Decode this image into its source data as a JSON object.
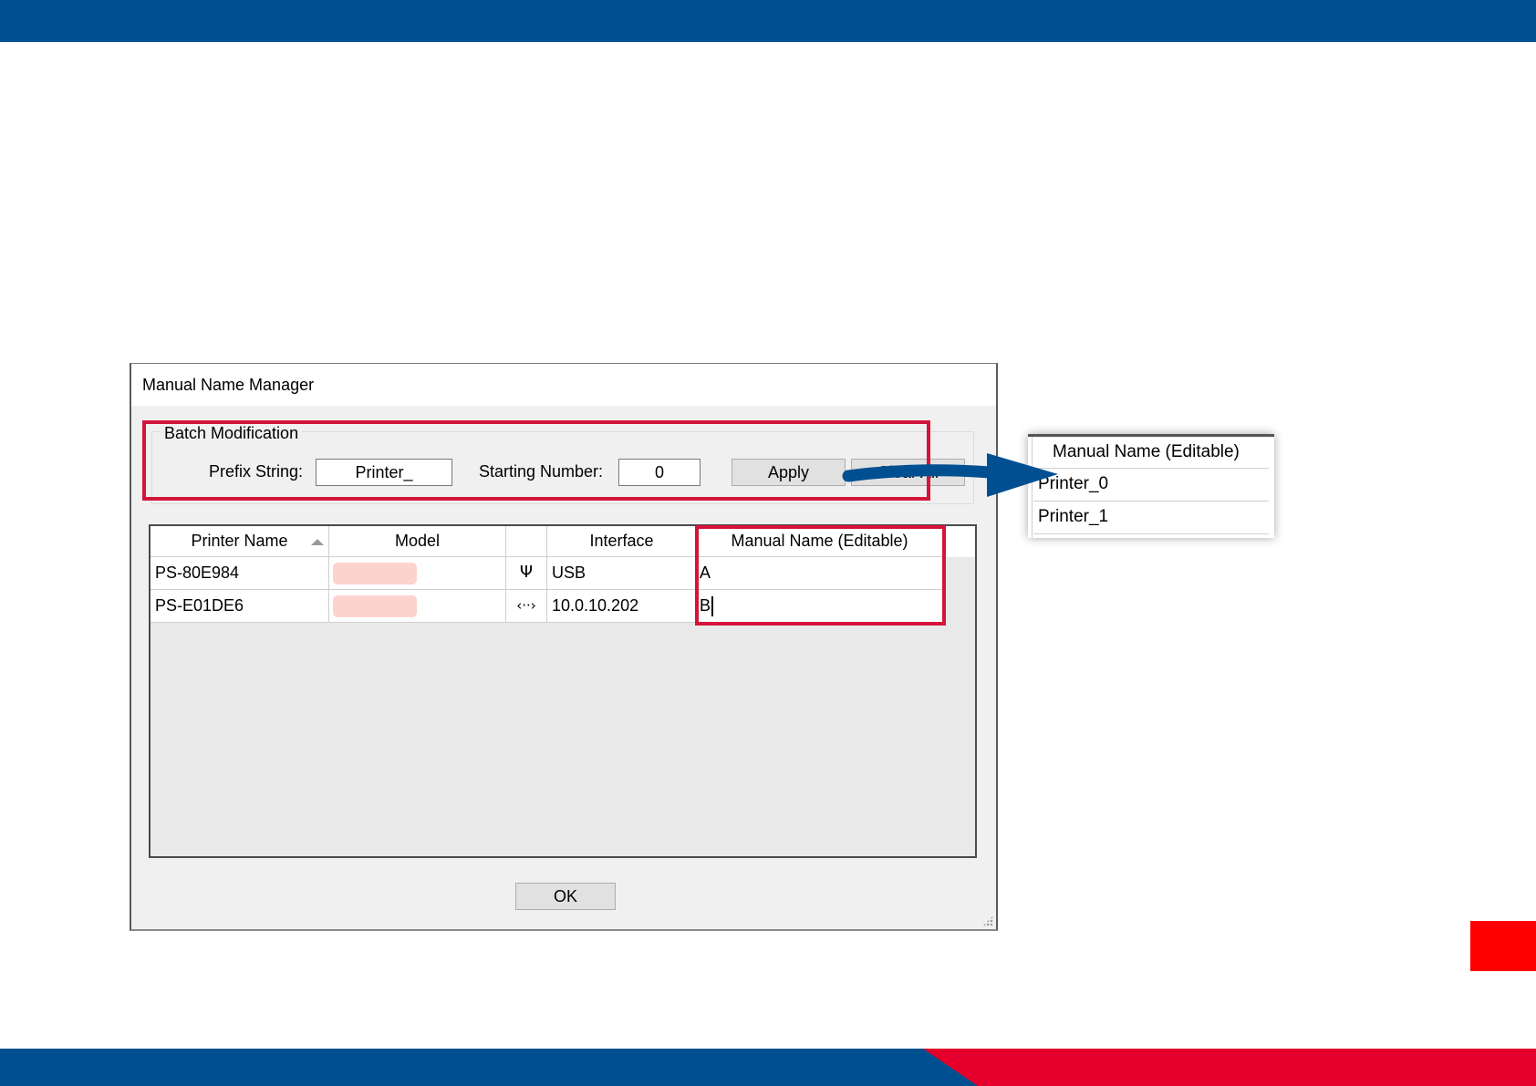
{
  "dialog": {
    "title": "Manual Name Manager",
    "batch_group": {
      "label": "Batch Modification",
      "prefix_label": "Prefix String:",
      "prefix_value": "Printer_",
      "starting_label": "Starting Number:",
      "starting_value": "0",
      "apply_label": "Apply",
      "clear_label": "Clear All"
    },
    "table": {
      "columns": [
        "Printer Name",
        "Model",
        "",
        "Interface",
        "Manual Name (Editable)"
      ],
      "rows": [
        {
          "printer_name": "PS-80E984",
          "interface_icon": "usb-icon",
          "interface_glyph": "Ψ",
          "interface": "USB",
          "manual_name": "A"
        },
        {
          "printer_name": "PS-E01DE6",
          "interface_icon": "network-icon",
          "interface_glyph": "‹··›",
          "interface": "10.0.10.202",
          "manual_name": "B"
        }
      ]
    },
    "ok_label": "OK"
  },
  "callout": {
    "header": "Manual Name (Editable)",
    "rows": [
      "Printer_0",
      "Printer_1"
    ]
  },
  "colors": {
    "brand_blue": "#005091",
    "brand_red": "#e4002b",
    "highlight": "#d4143a"
  }
}
